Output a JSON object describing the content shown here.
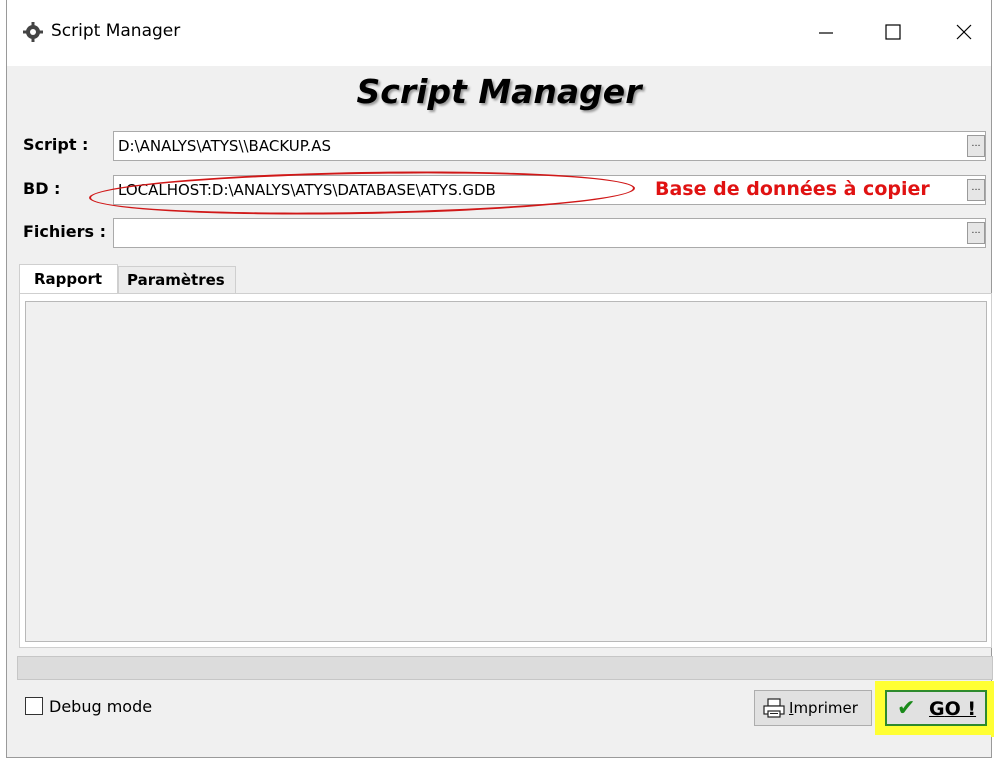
{
  "window": {
    "title": "Script Manager",
    "icon": "gear-script-icon",
    "controls": [
      "minimize-icon",
      "maximize-icon",
      "close-icon"
    ]
  },
  "banner": {
    "title": "Script Manager"
  },
  "fields": {
    "script": {
      "label": "Script :",
      "value": "D:\\ANALYS\\ATYS\\\\BACKUP.AS",
      "browse_label": "..."
    },
    "bd": {
      "label": "BD :",
      "value": "LOCALHOST:D:\\ANALYS\\ATYS\\DATABASE\\ATYS.GDB",
      "browse_label": "..."
    },
    "fichiers": {
      "label": "Fichiers :",
      "value": "",
      "browse_label": "..."
    }
  },
  "annotation": {
    "text": "Base de données à copier",
    "color": "#e01212"
  },
  "tabs": [
    {
      "label": "Rapport",
      "active": true
    },
    {
      "label": "Paramètres",
      "active": false
    }
  ],
  "debug": {
    "label": "Debug mode",
    "checked": false
  },
  "buttons": {
    "print": {
      "label_first": "I",
      "label_rest": "mprimer",
      "icon": "printer-icon"
    },
    "go": {
      "label_first": "G",
      "label_rest": "O !",
      "icon": "check-icon",
      "highlight_color": "#ffff33"
    }
  }
}
